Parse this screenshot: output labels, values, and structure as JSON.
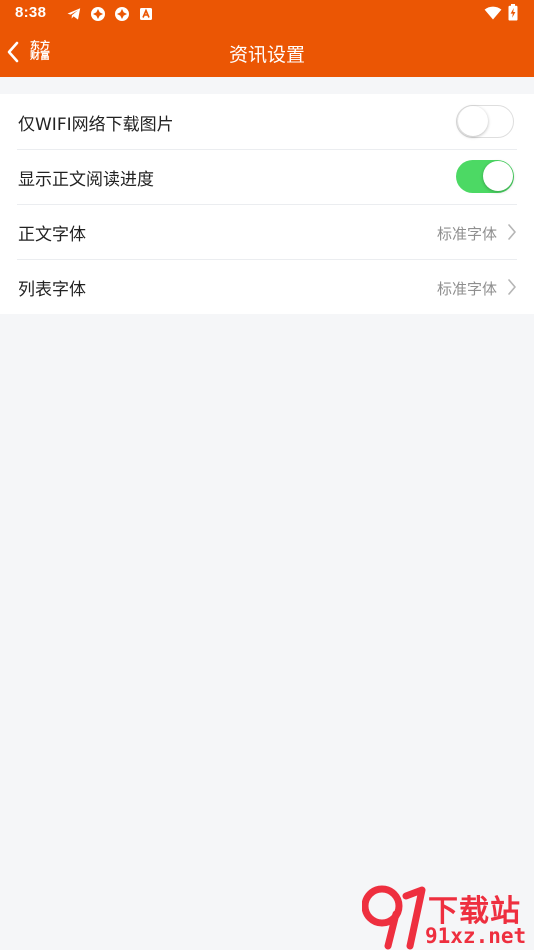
{
  "status_bar": {
    "time": "8:38",
    "left_icons": [
      "telegram-icon",
      "app-flower-icon",
      "app-flower-icon",
      "letter-a-icon"
    ],
    "right_icons": [
      "wifi-icon",
      "battery-charging-icon"
    ]
  },
  "nav": {
    "title": "资讯设置",
    "logo_line1": "东方",
    "logo_line2": "财富",
    "back_icon": "chevron-left-icon"
  },
  "settings": {
    "wifi_images": {
      "label": "仅WIFI网络下载图片",
      "enabled": false
    },
    "reading_progress": {
      "label": "显示正文阅读进度",
      "enabled": true
    },
    "body_font": {
      "label": "正文字体",
      "value": "标准字体"
    },
    "list_font": {
      "label": "列表字体",
      "value": "标准字体"
    }
  },
  "watermark": {
    "title": "下载站",
    "url": "91xz.net"
  },
  "colors": {
    "brand": "#eb5604",
    "toggle_on": "#4cd964",
    "background": "#f5f6f8",
    "watermark": "#ee2f3f"
  }
}
